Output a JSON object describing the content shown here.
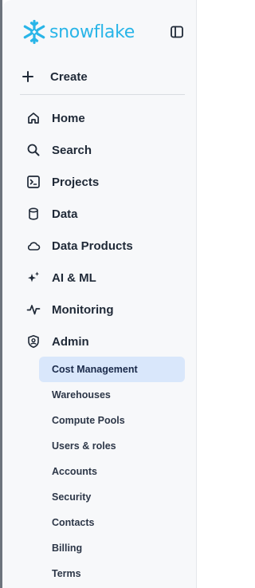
{
  "brand": {
    "name": "snowflake",
    "logo_color": "#29b5e8"
  },
  "header": {
    "collapse_icon": "sidebar-toggle-icon"
  },
  "create": {
    "label": "Create",
    "icon": "plus-icon"
  },
  "nav": [
    {
      "label": "Home",
      "icon": "home-icon"
    },
    {
      "label": "Search",
      "icon": "search-icon"
    },
    {
      "label": "Projects",
      "icon": "terminal-icon"
    },
    {
      "label": "Data",
      "icon": "database-icon"
    },
    {
      "label": "Data Products",
      "icon": "cloud-icon"
    },
    {
      "label": "AI & ML",
      "icon": "sparkle-icon"
    },
    {
      "label": "Monitoring",
      "icon": "activity-icon"
    },
    {
      "label": "Admin",
      "icon": "shield-user-icon"
    }
  ],
  "admin_sub": [
    {
      "label": "Cost Management",
      "active": true
    },
    {
      "label": "Warehouses"
    },
    {
      "label": "Compute Pools"
    },
    {
      "label": "Users & roles"
    },
    {
      "label": "Accounts"
    },
    {
      "label": "Security"
    },
    {
      "label": "Contacts"
    },
    {
      "label": "Billing"
    },
    {
      "label": "Terms"
    }
  ],
  "colors": {
    "active_bg": "#d9e7fb",
    "text": "#1f2937",
    "sidebar_bg": "#f7f8fa"
  }
}
